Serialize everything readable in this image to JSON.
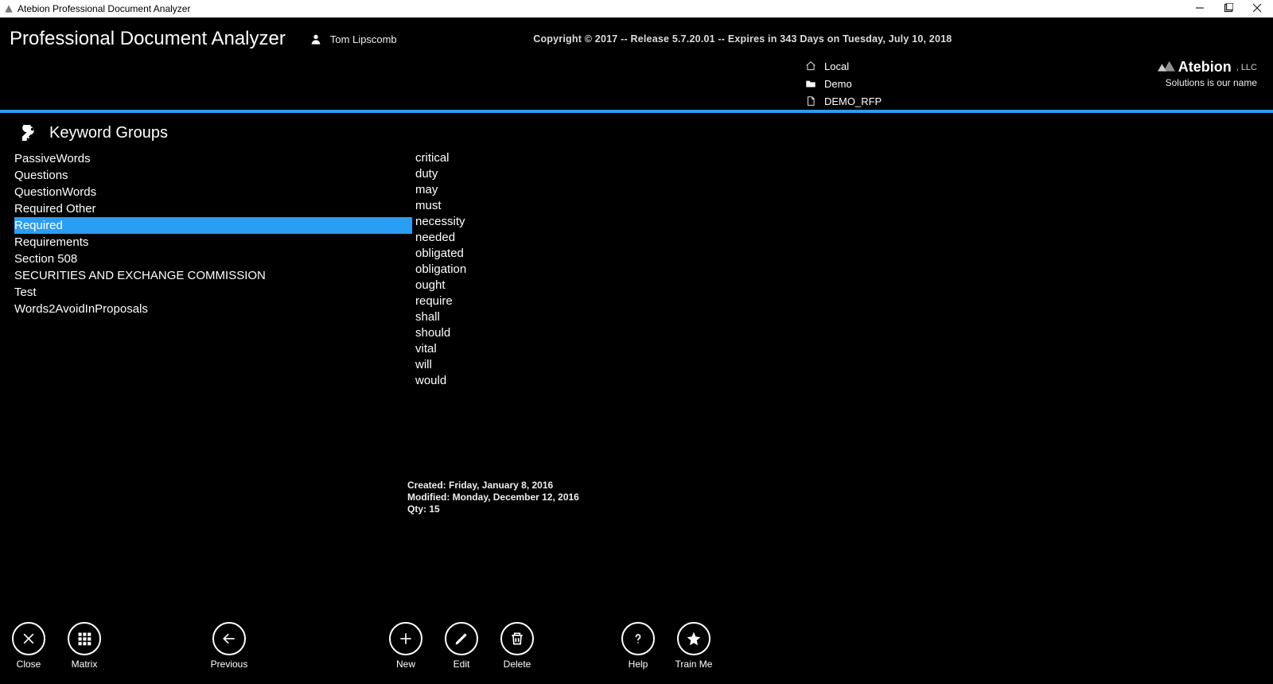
{
  "window": {
    "title": "Atebion Professional Document Analyzer"
  },
  "header": {
    "app_title": "Professional Document Analyzer",
    "user_name": "Tom Lipscomb",
    "copyright": "Copyright © 2017 -- Release 5.7.20.01 -- Expires in 343 Days on Tuesday, July 10, 2018"
  },
  "breadcrumbs": {
    "local": "Local",
    "project": "Demo",
    "document": "DEMO_RFP"
  },
  "brand": {
    "name": "Atebion",
    "suffix": ", LLC",
    "tagline": "Solutions is our name"
  },
  "section": {
    "title": "Keyword Groups"
  },
  "groups": [
    "PassiveWords",
    "Questions",
    "QuestionWords",
    "Required Other",
    "Required",
    "Requirements",
    "Section 508",
    "SECURITIES AND EXCHANGE COMMISSION",
    "Test",
    "Words2AvoidInProposals"
  ],
  "selected_group_index": 4,
  "keywords": [
    "critical",
    "duty",
    "may",
    "must",
    "necessity",
    "needed",
    "obligated",
    "obligation",
    "ought",
    "require",
    "shall",
    "should",
    "vital",
    "will",
    "would"
  ],
  "meta": {
    "created": "Created: Friday, January 8, 2016",
    "modified": "Modified: Monday, December 12, 2016",
    "qty": "Qty: 15"
  },
  "toolbar": {
    "close": "Close",
    "matrix": "Matrix",
    "previous": "Previous",
    "new": "New",
    "edit": "Edit",
    "delete": "Delete",
    "help": "Help",
    "trainme": "Train Me"
  }
}
